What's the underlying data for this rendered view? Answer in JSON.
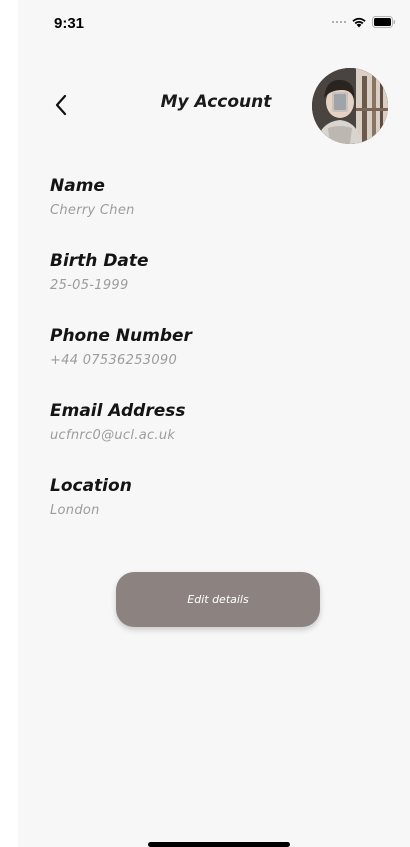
{
  "status_bar": {
    "time": "9:31",
    "icons": [
      "signal-icon",
      "wifi-icon",
      "battery-icon"
    ]
  },
  "header": {
    "title": "My Account",
    "back_icon": "chevron-left-icon"
  },
  "fields": [
    {
      "label": "Name",
      "value": "Cherry Chen"
    },
    {
      "label": "Birth Date",
      "value": "25-05-1999"
    },
    {
      "label": "Phone Number",
      "value": "+44 07536253090"
    },
    {
      "label": "Email Address",
      "value": "ucfnrc0@ucl.ac.uk"
    },
    {
      "label": "Location",
      "value": "London"
    }
  ],
  "actions": {
    "edit_label": "Edit details"
  },
  "colors": {
    "background": "#f7f7f7",
    "button": "#8c8380",
    "label": "#141414",
    "value": "#9c9c9c"
  }
}
